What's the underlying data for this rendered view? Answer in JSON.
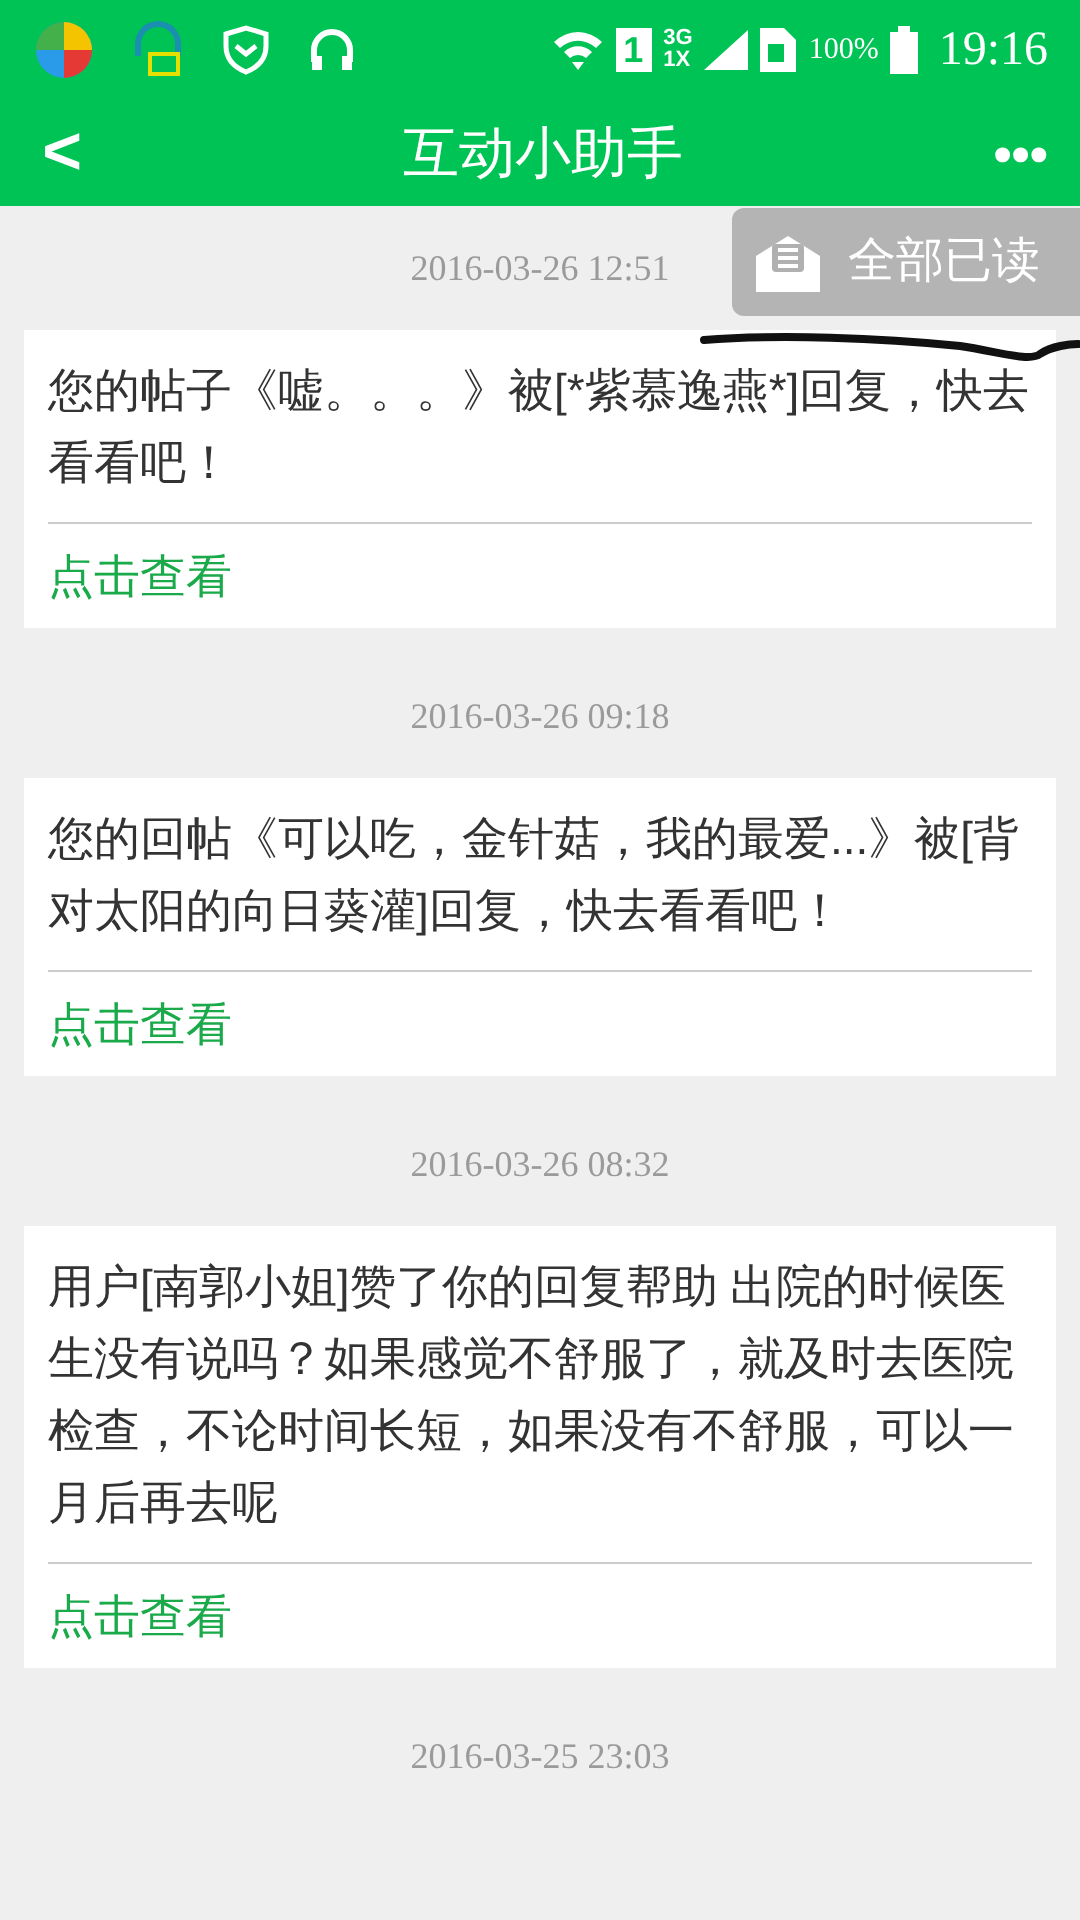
{
  "status_bar": {
    "sim_slot": "1",
    "network_top": "3G",
    "network_bottom": "1X",
    "battery": "100%",
    "time": "19:16"
  },
  "header": {
    "back": "<",
    "title": "互动小助手",
    "more": "•••"
  },
  "popup": {
    "label": "全部已读"
  },
  "messages": [
    {
      "time": "2016-03-26 12:51",
      "text": "您的帖子《嘘。。。》被[*紫慕逸燕*]回复，快去看看吧！",
      "action": "点击查看"
    },
    {
      "time": "2016-03-26 09:18",
      "text": "您的回帖《可以吃，金针菇，我的最爱...》被[背对太阳的向日葵灌]回复，快去看看吧！",
      "action": "点击查看"
    },
    {
      "time": "2016-03-26 08:32",
      "text": "用户[南郭小姐]赞了你的回复帮助 出院的时候医生没有说吗？如果感觉不舒服了，就及时去医院检查，不论时间长短，如果没有不舒服，可以一月后再去呢",
      "action": "点击查看"
    },
    {
      "time": "2016-03-25 23:03"
    }
  ]
}
